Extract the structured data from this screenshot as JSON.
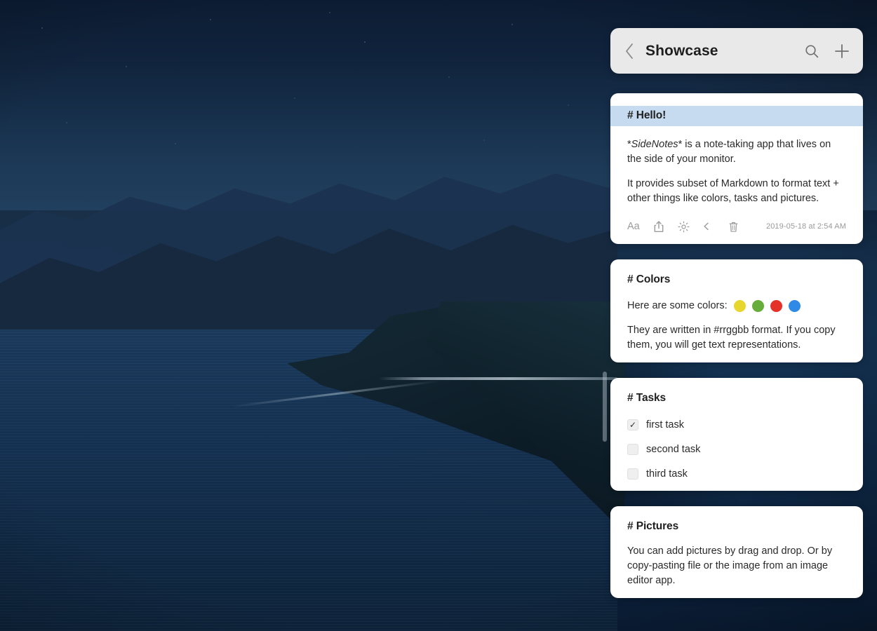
{
  "app": {
    "name": "SideNotes"
  },
  "header": {
    "back_icon": "chevron-left-icon",
    "title": "Showcase",
    "search_icon": "search-icon",
    "add_icon": "plus-icon"
  },
  "notes": [
    {
      "heading": "# Hello!",
      "heading_highlighted": true,
      "paragraphs": [
        {
          "prefix": "*",
          "italic": "SideNotes",
          "suffix": "* is a note-taking app that lives on the side of your monitor."
        },
        {
          "plain": "It provides subset of Markdown to format text + other things like colors, tasks and pictures."
        }
      ],
      "toolbar": {
        "font_icon": "Aa",
        "share_icon": "share-icon",
        "settings_icon": "gear-icon",
        "undo_icon": "undo-icon",
        "delete_icon": "trash-icon",
        "timestamp": "2019-05-18 at 2:54 AM"
      }
    },
    {
      "heading": "# Colors",
      "colors_label": "Here are some colors:",
      "swatches": [
        {
          "name": "yellow",
          "hex": "#e6d62e"
        },
        {
          "name": "green",
          "hex": "#66ad3c"
        },
        {
          "name": "red",
          "hex": "#e53229"
        },
        {
          "name": "blue",
          "hex": "#2e8ae6"
        }
      ],
      "paragraph": "They are written in #rrggbb format. If you copy them, you will get text representations."
    },
    {
      "heading": "# Tasks",
      "tasks": [
        {
          "label": "first task",
          "checked": true,
          "check_glyph": "✓"
        },
        {
          "label": "second task",
          "checked": false,
          "check_glyph": ""
        },
        {
          "label": "third task",
          "checked": false,
          "check_glyph": ""
        }
      ]
    },
    {
      "heading": "# Pictures",
      "paragraph": "You can add pictures by drag and drop. Or by copy-pasting file or the image from an image editor app."
    }
  ],
  "scrollbar": {
    "name": "vertical-scrollbar"
  },
  "theme": {
    "card_background": "#ffffff",
    "header_background": "#e9e9e9",
    "heading_highlight": "#c7dbf0",
    "text_primary": "#2a2a2a",
    "text_muted": "#9a9a9a"
  }
}
